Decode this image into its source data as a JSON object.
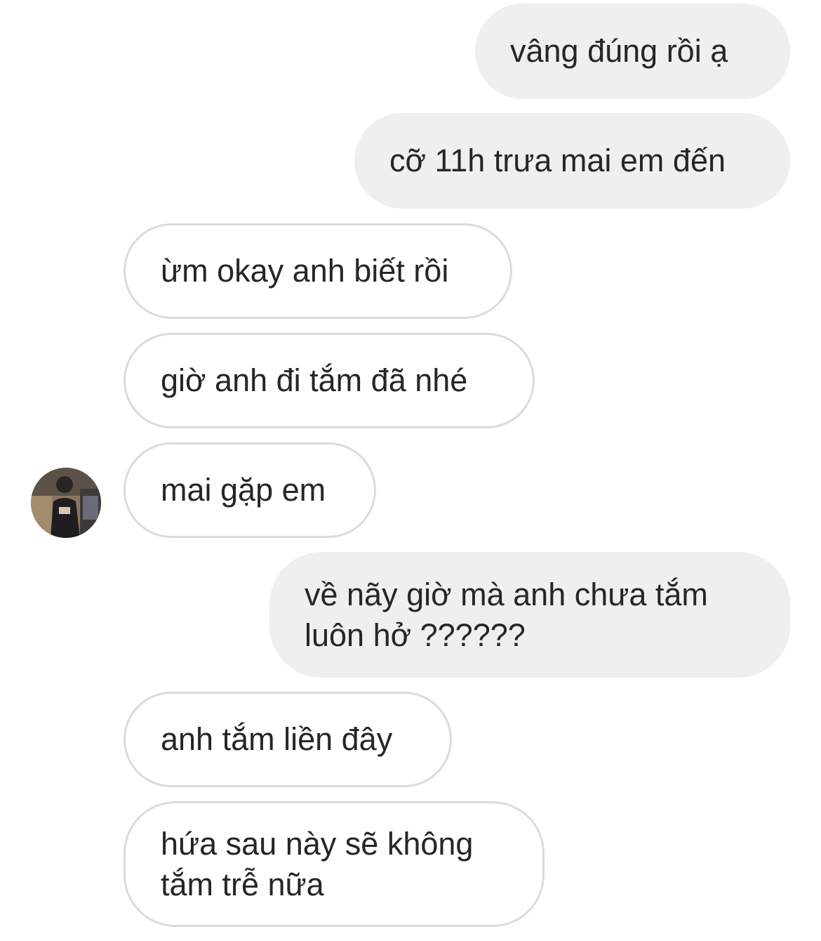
{
  "conversation": {
    "messages": [
      {
        "sender": "me",
        "text": "vâng đúng rồi ạ"
      },
      {
        "sender": "me",
        "text": "cỡ 11h trưa mai em đến"
      },
      {
        "sender": "other",
        "text": "ừm okay anh biết rồi"
      },
      {
        "sender": "other",
        "text": "giờ anh đi tắm đã nhé"
      },
      {
        "sender": "other",
        "text": "mai gặp em"
      },
      {
        "sender": "me",
        "text": "về nãy giờ mà anh chưa tắm\nluôn hở ??????"
      },
      {
        "sender": "other",
        "text": "anh tắm liền đây"
      },
      {
        "sender": "other",
        "text": "hứa sau này sẽ không\ntắm trễ nữa"
      }
    ]
  },
  "colors": {
    "sent_bubble": "#efefef",
    "received_border": "#dbdbdb",
    "text": "#262626",
    "background": "#ffffff"
  },
  "icons": {
    "avatar": "contact-avatar-photo"
  }
}
